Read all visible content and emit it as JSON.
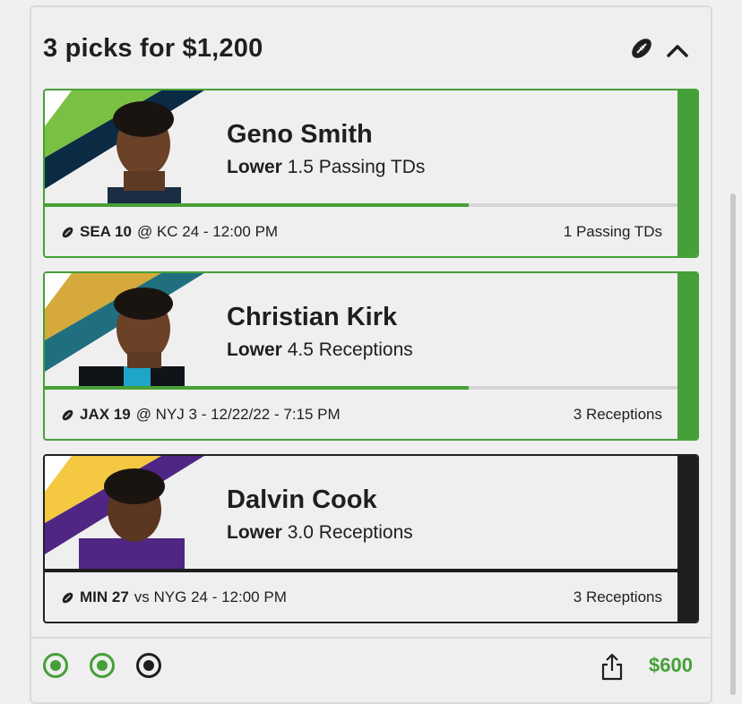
{
  "header": {
    "title": "3 picks for $1,200"
  },
  "picks": [
    {
      "name": "Geno Smith",
      "direction": "Lower",
      "line": "1.5 Passing TDs",
      "team": "SEA 10",
      "matchup": "@ KC 24 - 12:00 PM",
      "result": "1 Passing TDs",
      "progress": 0.67,
      "status": "hit"
    },
    {
      "name": "Christian Kirk",
      "direction": "Lower",
      "line": "4.5 Receptions",
      "team": "JAX 19",
      "matchup": "@ NYJ 3 - 12/22/22 - 7:15 PM",
      "result": "3 Receptions",
      "progress": 0.67,
      "status": "hit"
    },
    {
      "name": "Dalvin Cook",
      "direction": "Lower",
      "line": "3.0 Receptions",
      "team": "MIN 27",
      "matchup": "vs NYG 24 - 12:00 PM",
      "result": "3 Receptions",
      "progress": 1.0,
      "status": "pending"
    }
  ],
  "footer": {
    "payout": "$600"
  },
  "colors": {
    "green": "#46a038",
    "dark": "#1e1e1e"
  },
  "icons": {
    "sport": "football-icon",
    "collapse": "chevron-up-icon",
    "share": "share-icon"
  }
}
